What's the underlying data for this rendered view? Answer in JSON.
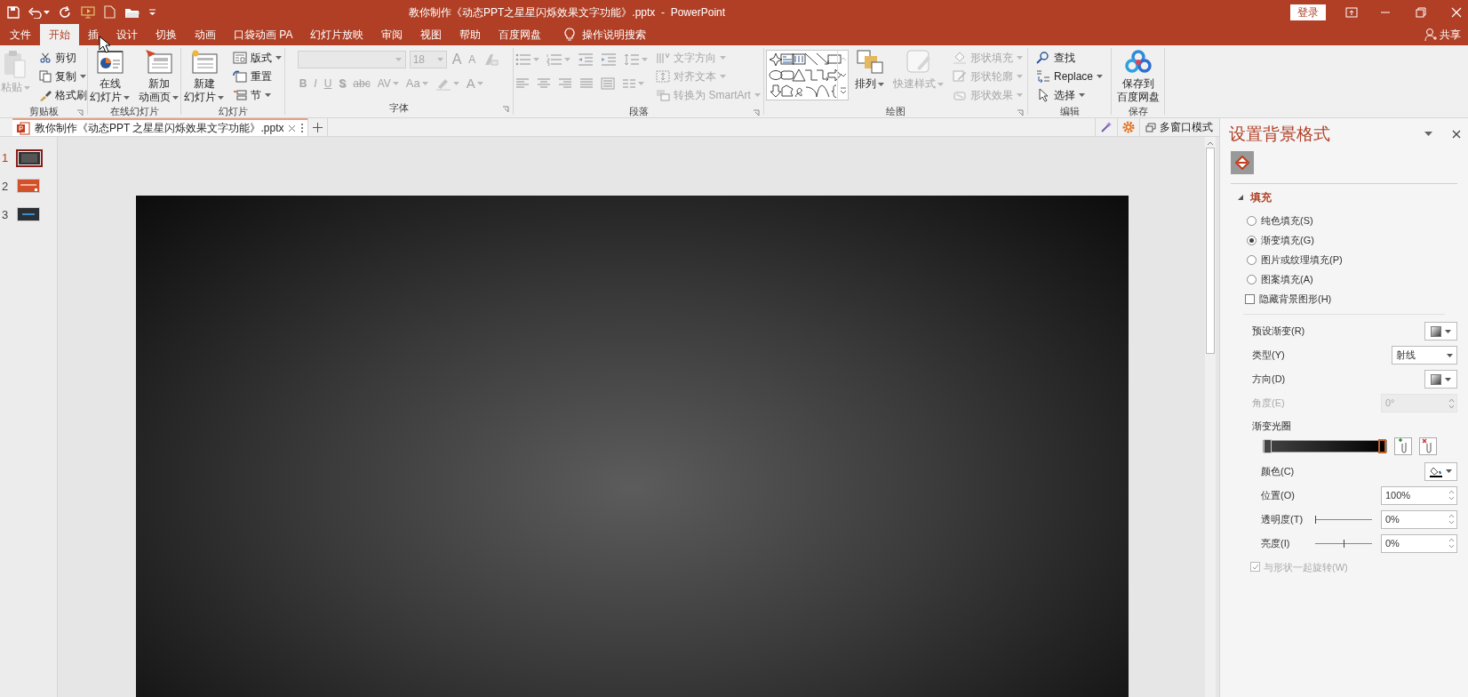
{
  "window": {
    "title": "教你制作《动态PPT之星星闪烁效果文字功能》.pptx  -  PowerPoint",
    "login_button": "登录"
  },
  "ribbon_tabs": [
    {
      "label": "文件",
      "selected": false
    },
    {
      "label": "开始",
      "selected": true
    },
    {
      "label": "插",
      "selected": false
    },
    {
      "label": "设计",
      "selected": false
    },
    {
      "label": "切换",
      "selected": false
    },
    {
      "label": "动画",
      "selected": false
    },
    {
      "label": "口袋动画 PA",
      "selected": false
    },
    {
      "label": "幻灯片放映",
      "selected": false
    },
    {
      "label": "审阅",
      "selected": false
    },
    {
      "label": "视图",
      "selected": false
    },
    {
      "label": "帮助",
      "selected": false
    },
    {
      "label": "百度网盘",
      "selected": false
    }
  ],
  "tell_me_search": "操作说明搜索",
  "share_button": "共享",
  "ribbon_groups": [
    {
      "label": "剪贴板",
      "columns": [
        {
          "kind": "large",
          "lines": [
            "粘贴"
          ],
          "dropdown": true,
          "disabled": true
        },
        {
          "kind": "stack",
          "items": [
            {
              "label": "剪切",
              "dropdown": false,
              "disabled": false
            },
            {
              "label": "复制",
              "dropdown": true,
              "disabled": false
            },
            {
              "label": "格式刷",
              "dropdown": false,
              "disabled": false
            }
          ]
        }
      ]
    },
    {
      "label": "在线幻灯片",
      "columns": [
        {
          "kind": "large",
          "lines": [
            "在线",
            "幻灯片"
          ],
          "dropdown": true,
          "disabled": false
        },
        {
          "kind": "large",
          "lines": [
            "新加",
            "动画页"
          ],
          "dropdown": true,
          "disabled": false
        }
      ]
    },
    {
      "label": "幻灯片",
      "columns": [
        {
          "kind": "large",
          "lines": [
            "新建",
            "幻灯片"
          ],
          "dropdown": true,
          "disabled": false
        },
        {
          "kind": "stack",
          "items": [
            {
              "label": "版式",
              "dropdown": true,
              "disabled": false
            },
            {
              "label": "重置",
              "dropdown": false,
              "disabled": false
            },
            {
              "label": "节",
              "dropdown": true,
              "disabled": false
            }
          ]
        }
      ]
    },
    {
      "label": "字体",
      "columns": [
        {
          "kind": "toolbars",
          "top": {
            "items": [
              {
                "kind": "font-field",
                "dropdown": true,
                "disabled": true
              },
              {
                "kind": "size-field",
                "label": "18",
                "dropdown": true,
                "disabled": true
              },
              {
                "kind": "glyph",
                "label": "A",
                "dropdown": false,
                "disabled": true
              },
              {
                "kind": "glyph",
                "label": "A",
                "dropdown": false,
                "disabled": true
              },
              {
                "kind": "icon",
                "dropdown": false,
                "disabled": true
              }
            ]
          },
          "bottom": {
            "items": [
              {
                "kind": "glyph",
                "label": "B",
                "dropdown": false,
                "disabled": true
              },
              {
                "kind": "glyph",
                "label": "I",
                "dropdown": false,
                "disabled": true
              },
              {
                "kind": "glyph",
                "label": "U",
                "dropdown": false,
                "disabled": true
              },
              {
                "kind": "glyph",
                "label": "S",
                "dropdown": false,
                "disabled": true
              },
              {
                "kind": "glyph",
                "label": "abc",
                "dropdown": false,
                "disabled": true
              },
              {
                "kind": "glyph",
                "label": "AV",
                "dropdown": true,
                "disabled": true
              },
              {
                "kind": "glyph",
                "label": "Aa",
                "dropdown": true,
                "disabled": true
              },
              {
                "kind": "icon",
                "dropdown": true,
                "disabled": true
              },
              {
                "kind": "glyph",
                "label": "A",
                "dropdown": true,
                "disabled": true
              }
            ]
          }
        }
      ]
    },
    {
      "label": "段落",
      "columns": [
        {
          "kind": "toolbars",
          "top": {
            "items": [
              {
                "kind": "icon",
                "dropdown": true,
                "disabled": true
              },
              {
                "kind": "icon",
                "dropdown": true,
                "disabled": true
              },
              {
                "kind": "icon",
                "dropdown": false,
                "disabled": true
              },
              {
                "kind": "icon",
                "dropdown": false,
                "disabled": true
              },
              {
                "kind": "icon",
                "dropdown": true,
                "disabled": true
              }
            ]
          },
          "bottom": {
            "items": [
              {
                "kind": "icon",
                "dropdown": false,
                "disabled": true
              },
              {
                "kind": "icon",
                "dropdown": false,
                "disabled": true
              },
              {
                "kind": "icon",
                "dropdown": false,
                "disabled": true
              },
              {
                "kind": "icon",
                "dropdown": false,
                "disabled": true
              },
              {
                "kind": "icon",
                "dropdown": false,
                "disabled": true
              },
              {
                "kind": "icon",
                "dropdown": true,
                "disabled": true
              }
            ]
          }
        },
        {
          "kind": "stack",
          "items": [
            {
              "label": "文字方向",
              "dropdown": true,
              "disabled": true
            },
            {
              "label": "对齐文本",
              "dropdown": true,
              "disabled": true
            },
            {
              "label": "转换为 SmartArt",
              "dropdown": true,
              "disabled": true
            }
          ]
        }
      ]
    },
    {
      "label": "绘图",
      "columns": [
        {
          "kind": "gallery"
        },
        {
          "kind": "large",
          "lines": [
            "排列"
          ],
          "dropdown": true,
          "disabled": false
        },
        {
          "kind": "large",
          "lines": [
            "快速样式"
          ],
          "dropdown": true,
          "disabled": true
        },
        {
          "kind": "stack",
          "items": [
            {
              "label": "形状填充",
              "dropdown": true,
              "disabled": true
            },
            {
              "label": "形状轮廓",
              "dropdown": true,
              "disabled": true
            },
            {
              "label": "形状效果",
              "dropdown": true,
              "disabled": true
            }
          ]
        }
      ]
    },
    {
      "label": "编辑",
      "columns": [
        {
          "kind": "stack",
          "items": [
            {
              "label": "查找",
              "dropdown": false,
              "disabled": false
            },
            {
              "label": "Replace",
              "dropdown": true,
              "disabled": false
            },
            {
              "label": "选择",
              "dropdown": true,
              "disabled": false
            }
          ]
        }
      ]
    },
    {
      "label": "保存",
      "columns": [
        {
          "kind": "large",
          "lines": [
            "保存到",
            "百度网盘"
          ],
          "dropdown": false,
          "disabled": false
        }
      ]
    }
  ],
  "document_tab": {
    "title": "教你制作《动态PPT 之星星闪烁效果文字功能》.pptx"
  },
  "multi_window_button": "多窗口模式",
  "slides": [
    {
      "number": "1",
      "selected": true,
      "kind": "gradient"
    },
    {
      "number": "2",
      "selected": false,
      "kind": "orange"
    },
    {
      "number": "3",
      "selected": false,
      "kind": "banner"
    }
  ],
  "format_pane": {
    "title": "设置背景格式",
    "section": {
      "label": "填充",
      "expanded": true
    },
    "fill_options": [
      {
        "kind": "radio",
        "label": "纯色填充(S)",
        "checked": false
      },
      {
        "kind": "radio",
        "label": "渐变填充(G)",
        "checked": true
      },
      {
        "kind": "radio",
        "label": "图片或纹理填充(P)",
        "checked": false
      },
      {
        "kind": "radio",
        "label": "图案填充(A)",
        "checked": false
      },
      {
        "kind": "checkbox",
        "label": "隐藏背景图形(H)",
        "checked": false
      }
    ],
    "settings": [
      {
        "kind": "swatch",
        "label": "预设渐变(R)",
        "disabled": false
      },
      {
        "kind": "select",
        "label": "类型(Y)",
        "value": "射线",
        "disabled": false
      },
      {
        "kind": "swatch",
        "label": "方向(D)",
        "disabled": false
      },
      {
        "kind": "spin",
        "label": "角度(E)",
        "value": "0°",
        "disabled": true
      }
    ],
    "gradient_stops_label": "渐变光圈",
    "stops": [
      {
        "selected": false
      },
      {
        "selected": true
      }
    ],
    "stop_settings": [
      {
        "kind": "color",
        "label": "颜色(C)"
      },
      {
        "kind": "spin",
        "label": "位置(O)",
        "value": "100%"
      },
      {
        "kind": "slider",
        "label": "透明度(T)",
        "level": 0,
        "value": "0%"
      },
      {
        "kind": "slider",
        "label": "亮度(I)",
        "level": 0.5,
        "value": "0%"
      }
    ],
    "rotate_with_shape": {
      "label": "与形状一起旋转(W)",
      "checked": true,
      "disabled": true
    }
  }
}
